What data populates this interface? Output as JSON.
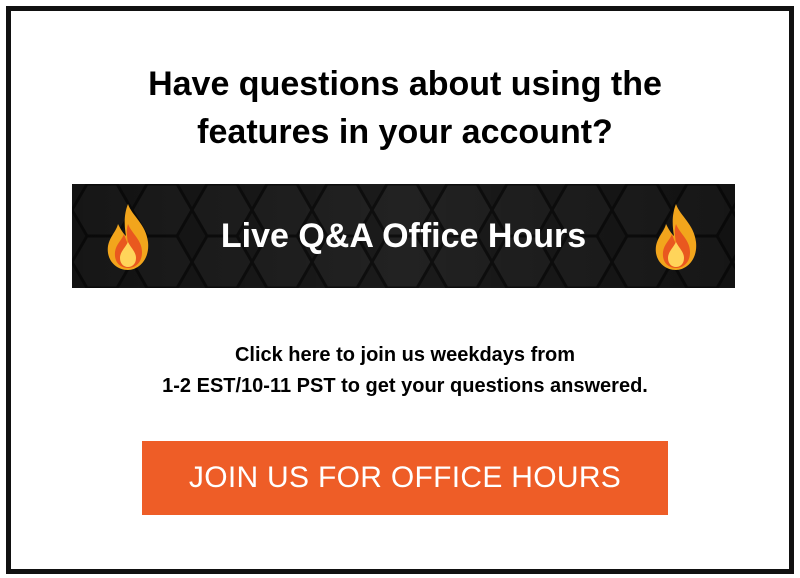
{
  "headline": {
    "line1": "Have questions about using the",
    "line2": "features in your account?"
  },
  "banner": {
    "title": "Live Q&A Office Hours",
    "left_icon": "flame-icon",
    "right_icon": "flame-icon",
    "background_color": "#1b1b1b"
  },
  "info": {
    "line1": "Click here to join us weekdays from",
    "line2_bold": "1-2 EST/10-11 PST",
    "line2_rest": " to get your questions answered."
  },
  "cta": {
    "label": "JOIN US FOR OFFICE HOURS",
    "color": "#ee5d27"
  }
}
